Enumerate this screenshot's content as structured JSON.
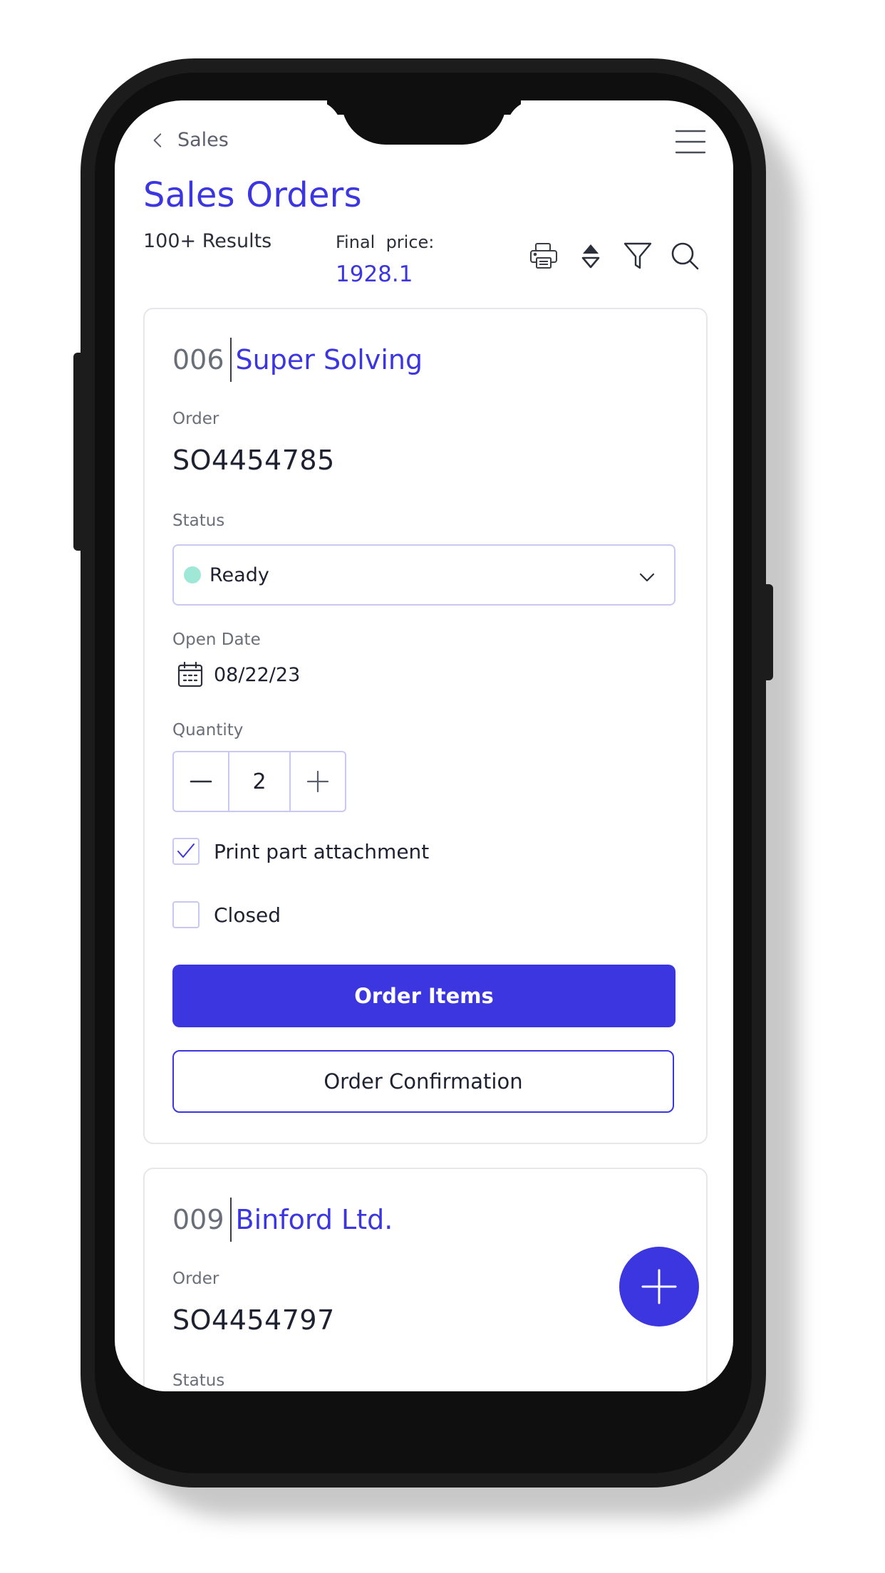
{
  "header": {
    "back_label": "Sales",
    "title": "Sales Orders",
    "results": "100+ Results",
    "final_price_label": "Final  price:",
    "final_price_value": "1928.1"
  },
  "toolbar_icons": [
    "print-icon",
    "sort-icon",
    "filter-icon",
    "search-icon"
  ],
  "orders": [
    {
      "number": "006",
      "customer": "Super Solving",
      "order_label": "Order",
      "order_id": "SO4454785",
      "status_label": "Status",
      "status_value": "Ready",
      "open_date_label": "Open Date",
      "open_date": "08/22/23",
      "quantity_label": "Quantity",
      "quantity": "2",
      "print_attachment_label": "Print part attachment",
      "print_attachment_checked": true,
      "closed_label": "Closed",
      "closed_checked": false,
      "order_items_button": "Order Items",
      "order_confirmation_button": "Order Confirmation"
    },
    {
      "number": "009",
      "customer": "Binford Ltd.",
      "order_label": "Order",
      "order_id": "SO4454797",
      "status_label": "Status"
    }
  ],
  "colors": {
    "accent": "#3c36e0",
    "status_ready": "#9fe8d7",
    "border": "#c9c8f2"
  }
}
